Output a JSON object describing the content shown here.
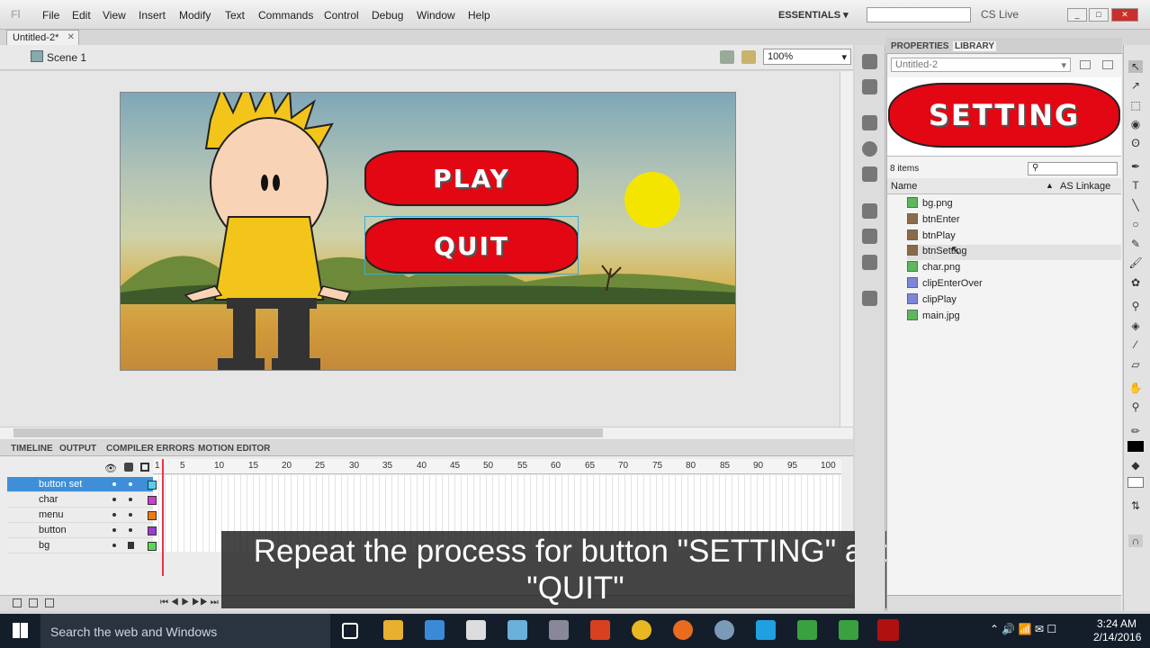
{
  "app": {
    "logo": "Fl",
    "workspace": "ESSENTIALS",
    "cslive": "CS Live"
  },
  "menu": [
    "File",
    "Edit",
    "View",
    "Insert",
    "Modify",
    "Text",
    "Commands",
    "Control",
    "Debug",
    "Window",
    "Help"
  ],
  "document": {
    "tab": "Untitled-2*",
    "scene": "Scene 1",
    "zoom": "100%"
  },
  "stage": {
    "buttons": [
      "PLAY",
      "QUIT"
    ]
  },
  "timeline": {
    "tabs": [
      "TIMELINE",
      "OUTPUT",
      "COMPILER ERRORS",
      "MOTION EDITOR"
    ],
    "frame_numbers": [
      "1",
      "5",
      "10",
      "15",
      "20",
      "25",
      "30",
      "35",
      "40",
      "45",
      "50",
      "55",
      "60",
      "65",
      "70",
      "75",
      "80",
      "85",
      "90",
      "95",
      "100"
    ],
    "layers": [
      {
        "name": "button set",
        "color": "#4fd0f0",
        "selected": true
      },
      {
        "name": "char",
        "color": "#d23ad2",
        "selected": false
      },
      {
        "name": "menu",
        "color": "#ee7a10",
        "selected": false
      },
      {
        "name": "button",
        "color": "#9d3ad2",
        "selected": false
      },
      {
        "name": "bg",
        "color": "#58d858",
        "selected": false
      }
    ]
  },
  "panels": {
    "tabs": [
      "PROPERTIES",
      "LIBRARY"
    ],
    "library": {
      "document": "Untitled-2",
      "preview": "SETTING",
      "count": "8 items",
      "columns": {
        "name": "Name",
        "linkage": "AS Linkage"
      },
      "items": [
        {
          "name": "bg.png",
          "kind": "bmp"
        },
        {
          "name": "btnEnter",
          "kind": "btn"
        },
        {
          "name": "btnPlay",
          "kind": "btn"
        },
        {
          "name": "btnSetting",
          "kind": "btn"
        },
        {
          "name": "char.png",
          "kind": "bmp"
        },
        {
          "name": "clipEnterOver",
          "kind": "mc"
        },
        {
          "name": "clipPlay",
          "kind": "mc"
        },
        {
          "name": "main.jpg",
          "kind": "bmp"
        }
      ]
    }
  },
  "caption": {
    "line1": "Repeat the process for button \"SETTING\" and",
    "line2": "\"QUIT\""
  },
  "taskbar": {
    "search": "Search the web and Windows",
    "time": "3:24 AM",
    "date": "2/14/2016"
  },
  "colors": {
    "button_red": "#e30613",
    "selection_blue": "#3e8fd8",
    "sun": "#f4e500"
  }
}
